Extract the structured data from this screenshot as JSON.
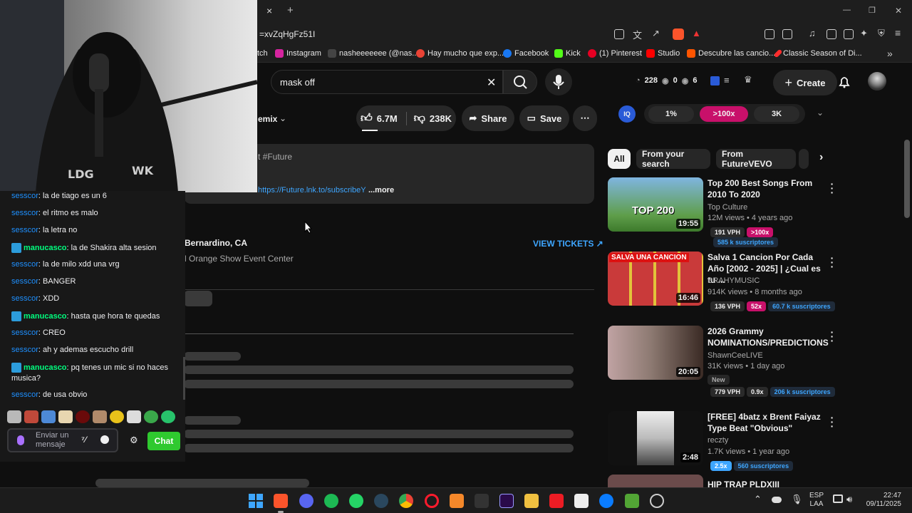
{
  "browser": {
    "tab_close": "×",
    "new_tab": "+",
    "url": "=xvZqHgFz51I",
    "window_controls": [
      "—",
      "❐",
      "✕"
    ],
    "bookmarks": [
      {
        "label": "tch"
      },
      {
        "label": "Instagram",
        "color": "#d6249f"
      },
      {
        "label": "nasheeeeeee (@nas...",
        "color": "#000000"
      },
      {
        "label": "Hay mucho que exp...",
        "color": "#ea4335"
      },
      {
        "label": "Facebook",
        "color": "#1877f2"
      },
      {
        "label": "Kick",
        "color": "#53fc18"
      },
      {
        "label": "(1) Pinterest",
        "color": "#e60023"
      },
      {
        "label": "Studio",
        "color": "#ff0000"
      },
      {
        "label": "Descubre las cancio...",
        "color": "#ff5500"
      },
      {
        "label": "Classic Season of Di...",
        "color": "#ff2d2d"
      }
    ],
    "more_bookmarks": "»"
  },
  "youtube": {
    "search_value": "mask off",
    "clear": "✕",
    "stats": {
      "a": "228",
      "b": "0",
      "c": "6"
    },
    "create_label": "Create",
    "like_count": "6.7M",
    "dislike_count": "238K",
    "share_label": "Share",
    "save_label": "Save",
    "remix_label": "emix",
    "desc_hashtag": "t #Future",
    "desc_link": "https://Future.lnk.to/subscribeY",
    "more_label": "...more",
    "event_location": "Bernardino, CA",
    "event_venue": "l Orange Show Event Center",
    "view_tickets": "VIEW TICKETS",
    "filters": {
      "f1": "1%",
      "f2": ">100x",
      "f3": "3K"
    },
    "chips": [
      "All",
      "From your search",
      "From FutureVEVO"
    ],
    "videos": [
      {
        "title": "Top 200 Best Songs From 2010 To 2020",
        "channel": "Top Culture",
        "meta": "12M views • 4 years ago",
        "duration": "19:55",
        "vph": "191 VPH",
        "mult": ">100x",
        "subs": "585 k suscriptores",
        "thumb_text": "TOP 200"
      },
      {
        "title": "Salva 1 Cancion Por Cada Año [2002 - 2025] | ¿Cual es tu ...",
        "channel": "BRAHYMUSIC",
        "meta": "914K views • 8 months ago",
        "duration": "16:46",
        "vph": "136 VPH",
        "mult": "52x",
        "subs": "60.7 k suscriptores",
        "thumb_text": "SALVA UNA CANCION"
      },
      {
        "title": "2026 Grammy NOMINATIONS/PREDICTIONS",
        "channel": "ShawnCeeLIVE",
        "meta": "31K views • 1 day ago",
        "duration": "20:05",
        "badge": "New",
        "vph": "779 VPH",
        "mult": "0.9x",
        "subs": "206 k suscriptores"
      },
      {
        "title": "[FREE] 4batz x Brent Faiyaz Type Beat \"Obvious\"",
        "channel": "reczty",
        "meta": "1.7K views • 1 year ago",
        "duration": "2:48",
        "mult": "2.5x",
        "subs": "560 suscriptores"
      },
      {
        "title": "HIP TRAP PLDXIII"
      }
    ]
  },
  "chat": {
    "messages": [
      {
        "user": "sesscor",
        "text": ": la de tiago es un 6",
        "type": "u1"
      },
      {
        "user": "sesscor",
        "text": ": el ritmo es malo",
        "type": "u1"
      },
      {
        "user": "sesscor",
        "text": ": la letra no",
        "type": "u1"
      },
      {
        "user": "manucasco",
        "text": ": la de Shakira alta sesion",
        "type": "u2"
      },
      {
        "user": "sesscor",
        "text": ": la de milo xdd una vrg",
        "type": "u1"
      },
      {
        "user": "sesscor",
        "text": ": BANGER",
        "type": "u1"
      },
      {
        "user": "sesscor",
        "text": ": XDD",
        "type": "u1"
      },
      {
        "user": "manucasco",
        "text": ": hasta que hora te quedas",
        "type": "u2"
      },
      {
        "user": "sesscor",
        "text": ": CREO",
        "type": "u1"
      },
      {
        "user": "sesscor",
        "text": ": ah y ademas escucho drill",
        "type": "u1"
      },
      {
        "user": "manucasco",
        "text": ": pq tenes un mic si no haces",
        "text2": "musica?",
        "type": "u2"
      },
      {
        "user": "sesscor",
        "text": ": de usa obvio",
        "type": "u1"
      }
    ],
    "input_placeholder": "Enviar un mensaje",
    "chat_button": "Chat"
  },
  "taskbar": {
    "lang": "ESP",
    "lang2": "LAA",
    "time": "22:47",
    "date": "09/11/2025"
  }
}
